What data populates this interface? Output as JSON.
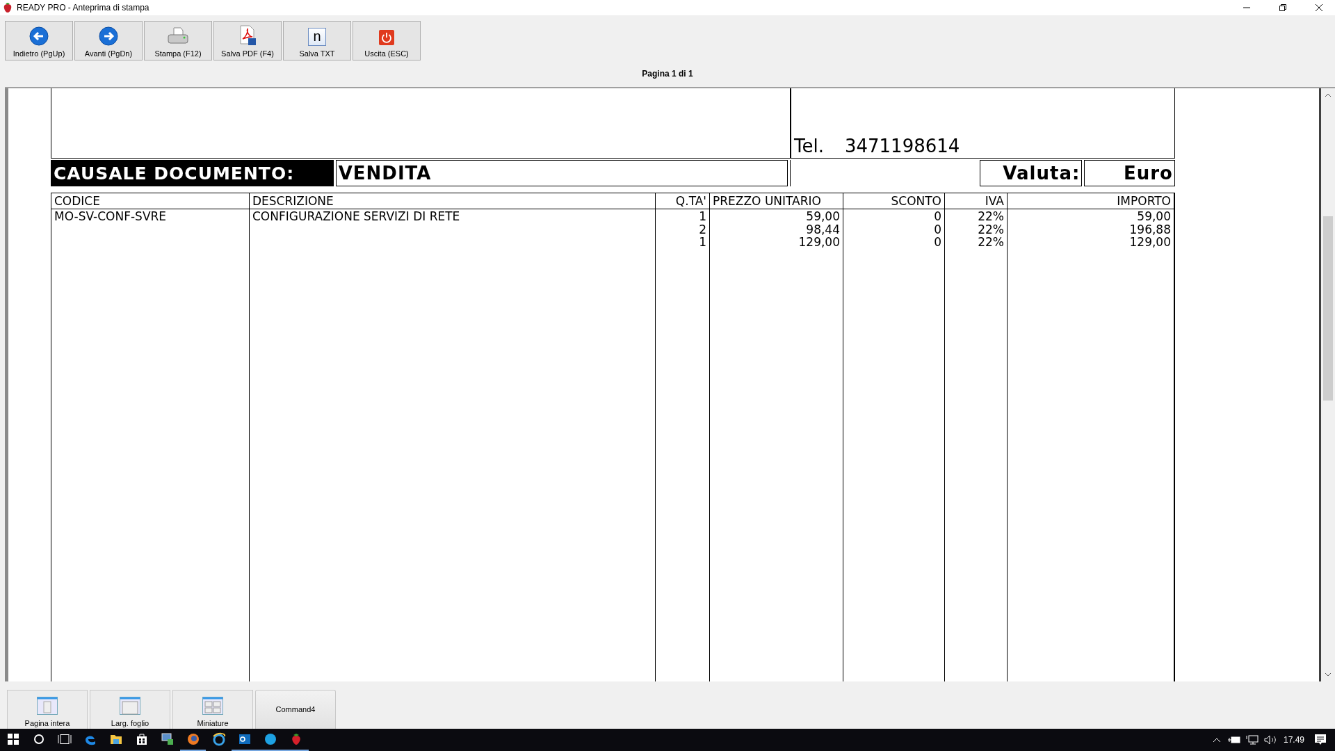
{
  "window": {
    "title": "READY PRO - Anteprima di stampa"
  },
  "toolbar": [
    {
      "kind": "back",
      "label": "Indietro (PgUp)"
    },
    {
      "kind": "forward",
      "label": "Avanti (PgDn)"
    },
    {
      "kind": "print",
      "label": "Stampa (F12)"
    },
    {
      "kind": "pdf",
      "label": "Salva PDF (F4)"
    },
    {
      "kind": "txt",
      "label": "Salva TXT",
      "glyph": "n"
    },
    {
      "kind": "exit",
      "label": "Uscita (ESC)"
    }
  ],
  "page_indicator": "Pagina 1 di 1",
  "document": {
    "phone_label": "Tel.",
    "phone": "3471198614",
    "causale_label": "CAUSALE DOCUMENTO:",
    "causale": "VENDITA",
    "currency_label": "Valuta:",
    "currency": "Euro",
    "table": {
      "columns": [
        "CODICE",
        "DESCRIZIONE",
        "Q.TA'",
        "PREZZO UNITARIO",
        "SCONTO",
        "IVA",
        "IMPORTO"
      ],
      "rows": [
        {
          "code": "MO-SV-CONF-SVRE",
          "description": "CONFIGURAZIONE SERVIZI DI RETE",
          "qty": "1",
          "price": "59,00",
          "discount": "0",
          "vat": "22%",
          "amount": "59,00"
        },
        {
          "qty": "2",
          "price": "98,44",
          "discount": "0",
          "vat": "22%",
          "amount": "196,88"
        },
        {
          "qty": "1",
          "price": "129,00",
          "discount": "0",
          "vat": "22%",
          "amount": "129,00"
        }
      ]
    }
  },
  "view_buttons": [
    {
      "kind": "full-page",
      "label": "Pagina intera"
    },
    {
      "kind": "page-width",
      "label": "Larg. foglio"
    },
    {
      "kind": "thumbnails",
      "label": "Miniature"
    },
    {
      "kind": "plain",
      "label": "Command4"
    }
  ],
  "taskbar": {
    "apps": [
      {
        "kind": "edge",
        "running": false
      },
      {
        "kind": "folder",
        "running": false
      },
      {
        "kind": "store",
        "running": false
      },
      {
        "kind": "remote",
        "running": false
      },
      {
        "kind": "firefox",
        "running": true
      },
      {
        "kind": "ie",
        "running": false
      },
      {
        "kind": "outlook",
        "running": true
      },
      {
        "kind": "skype",
        "running": true
      },
      {
        "kind": "strawberry",
        "running": true
      }
    ],
    "clock": "17.49"
  }
}
